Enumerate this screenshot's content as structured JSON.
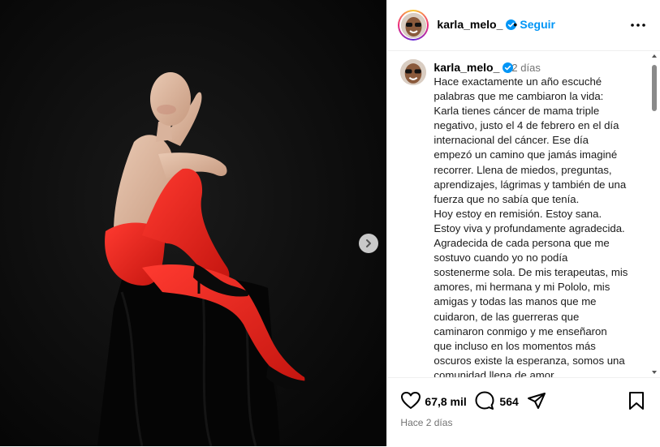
{
  "header": {
    "username": "karla_melo_",
    "separator": "•",
    "follow_label": "Seguir",
    "verified_icon": "verified-badge-icon",
    "more_icon": "more-options-icon"
  },
  "caption": {
    "username": "karla_melo_",
    "time": "2 días",
    "text": "Hace exactamente un año escuché\npalabras que me cambiaron la vida:\nKarla tienes cáncer de mama triple\nnegativo, justo el 4 de febrero en el día\ninternacional del cáncer. Ese día\nempezó un camino que jamás imaginé\nrecorrer. Llena de miedos, preguntas,\naprendizajes, lágrimas y también de una\nfuerza que no sabía que tenía.\nHoy estoy en remisión. Estoy sana.\nEstoy viva y profundamente agradecida.\nAgradecida de cada persona que me\nsostuvo cuando yo no podía\nsostenerme sola. De mis terapeutas, mis\namores, mi hermana y mi Pololo, mis\namigas y todas las manos que me\ncuidaron, de las guerreras que\ncaminaron conmigo y me enseñaron\nque incluso en los momentos más\noscuros existe la esperanza, somos una\ncomunidad llena de amor."
  },
  "actions": {
    "likes": "67,8 mil",
    "comments": "564",
    "posted": "Hace 2 días",
    "icons": [
      "heart-icon",
      "comment-icon",
      "share-icon",
      "bookmark-icon"
    ]
  },
  "media": {
    "next_icon": "chevron-right-icon"
  },
  "colors": {
    "accent": "#0095f6",
    "muted": "#737373",
    "border": "#efefef",
    "photo_bg": "#0c0c0c",
    "tights": "#e8231f"
  }
}
